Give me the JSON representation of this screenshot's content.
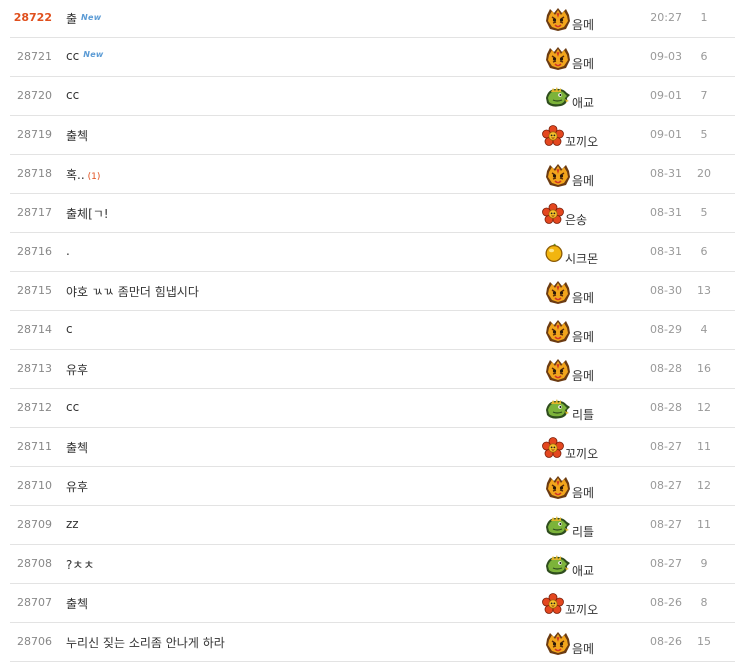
{
  "posts": [
    {
      "num": "28722",
      "title": "출",
      "is_new": true,
      "new_label": "New",
      "comments": "",
      "author": "음메",
      "author_icon": "tiger-icon",
      "date": "20:27",
      "hits": "1"
    },
    {
      "num": "28721",
      "title": "cc",
      "is_new": true,
      "new_label": "New",
      "comments": "",
      "author": "음메",
      "author_icon": "tiger-icon",
      "date": "09-03",
      "hits": "6"
    },
    {
      "num": "28720",
      "title": "cc",
      "is_new": false,
      "new_label": "",
      "comments": "",
      "author": "애교",
      "author_icon": "dragon-icon",
      "date": "09-01",
      "hits": "7"
    },
    {
      "num": "28719",
      "title": "출첵",
      "is_new": false,
      "new_label": "",
      "comments": "",
      "author": "꼬끼오",
      "author_icon": "flower-icon",
      "date": "09-01",
      "hits": "5"
    },
    {
      "num": "28718",
      "title": "혹..",
      "is_new": false,
      "new_label": "",
      "comments": "(1)",
      "author": "음메",
      "author_icon": "tiger-icon",
      "date": "08-31",
      "hits": "20"
    },
    {
      "num": "28717",
      "title": "출체[ㄱ!",
      "is_new": false,
      "new_label": "",
      "comments": "",
      "author": "은송",
      "author_icon": "flower-icon",
      "date": "08-31",
      "hits": "5"
    },
    {
      "num": "28716",
      "title": ".",
      "is_new": false,
      "new_label": "",
      "comments": "",
      "author": "시크몬",
      "author_icon": "bell-icon",
      "date": "08-31",
      "hits": "6"
    },
    {
      "num": "28715",
      "title": "야호 ㄳㄳ 좀만더 힘냅시다",
      "is_new": false,
      "new_label": "",
      "comments": "",
      "author": "음메",
      "author_icon": "tiger-icon",
      "date": "08-30",
      "hits": "13"
    },
    {
      "num": "28714",
      "title": "c",
      "is_new": false,
      "new_label": "",
      "comments": "",
      "author": "음메",
      "author_icon": "tiger-icon",
      "date": "08-29",
      "hits": "4"
    },
    {
      "num": "28713",
      "title": "유후",
      "is_new": false,
      "new_label": "",
      "comments": "",
      "author": "음메",
      "author_icon": "tiger-icon",
      "date": "08-28",
      "hits": "16"
    },
    {
      "num": "28712",
      "title": "cc",
      "is_new": false,
      "new_label": "",
      "comments": "",
      "author": "리틀",
      "author_icon": "dragon-icon",
      "date": "08-28",
      "hits": "12"
    },
    {
      "num": "28711",
      "title": "출첵",
      "is_new": false,
      "new_label": "",
      "comments": "",
      "author": "꼬끼오",
      "author_icon": "flower-icon",
      "date": "08-27",
      "hits": "11"
    },
    {
      "num": "28710",
      "title": "유후",
      "is_new": false,
      "new_label": "",
      "comments": "",
      "author": "음메",
      "author_icon": "tiger-icon",
      "date": "08-27",
      "hits": "12"
    },
    {
      "num": "28709",
      "title": "zz",
      "is_new": false,
      "new_label": "",
      "comments": "",
      "author": "리틀",
      "author_icon": "dragon-icon",
      "date": "08-27",
      "hits": "11"
    },
    {
      "num": "28708",
      "title": "?ㅊㅊ",
      "is_new": false,
      "new_label": "",
      "comments": "",
      "author": "애교",
      "author_icon": "dragon-icon",
      "date": "08-27",
      "hits": "9"
    },
    {
      "num": "28707",
      "title": "출첵",
      "is_new": false,
      "new_label": "",
      "comments": "",
      "author": "꼬끼오",
      "author_icon": "flower-icon",
      "date": "08-26",
      "hits": "8"
    },
    {
      "num": "28706",
      "title": "누리신 짖는 소리좀 안나게 하라",
      "is_new": false,
      "new_label": "",
      "comments": "",
      "author": "음메",
      "author_icon": "tiger-icon",
      "date": "08-26",
      "hits": "15"
    }
  ],
  "colors": {
    "current_num": "#e0501e",
    "comment_count": "#e0501e",
    "new_badge": "#5b9bd5",
    "row_border": "#e3e3e3",
    "text": "#333333",
    "muted": "#999999"
  }
}
